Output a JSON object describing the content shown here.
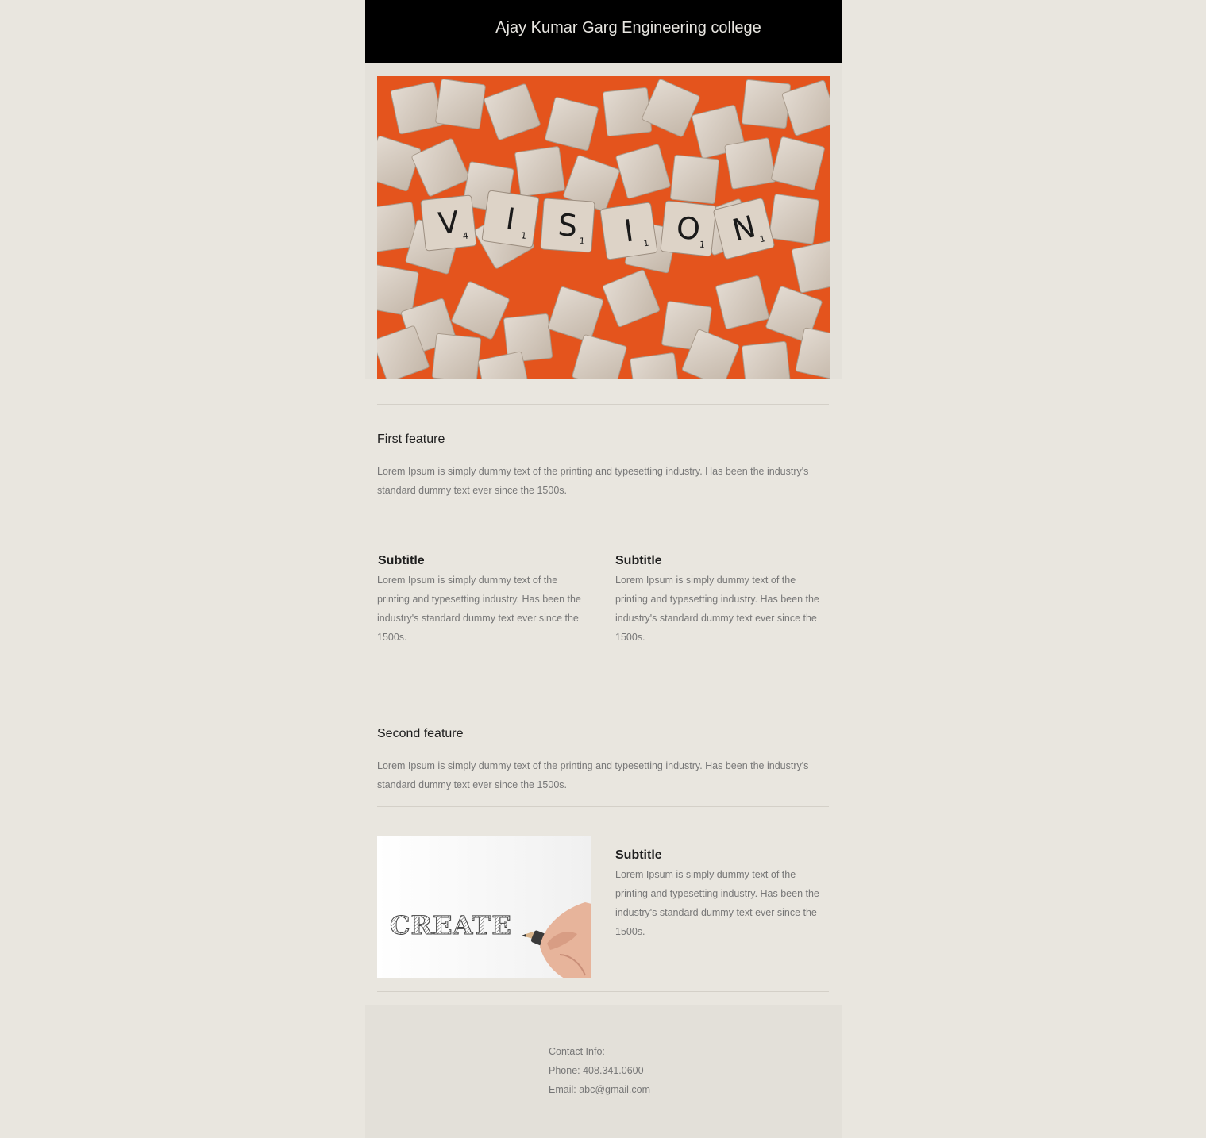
{
  "header": {
    "title": "Ajay Kumar Garg Engineering college"
  },
  "hero": {
    "tile_letters": [
      "V",
      "I",
      "S",
      "I",
      "O",
      "N"
    ],
    "tile_points": [
      "4",
      "1",
      "1",
      "1",
      "1",
      "1"
    ]
  },
  "features": [
    {
      "title": "First feature",
      "text": "Lorem Ipsum is simply dummy text of the printing and typesetting industry. Has been the industry's standard dummy text ever since the 1500s."
    },
    {
      "title": "Second feature",
      "text": "Lorem Ipsum is simply dummy text of the printing and typesetting industry. Has been the industry's standard dummy text ever since the 1500s."
    }
  ],
  "columns": [
    {
      "subtitle": "Subtitle",
      "text": "Lorem Ipsum is simply dummy text of the printing and typesetting industry. Has been the industry's standard dummy text ever since the 1500s."
    },
    {
      "subtitle": "Subtitle",
      "text": "Lorem Ipsum is simply dummy text of the printing and typesetting industry. Has been the industry's standard dummy text ever since the 1500s."
    }
  ],
  "create_section": {
    "image_word": "CREATE",
    "subtitle": "Subtitle",
    "text": "Lorem Ipsum is simply dummy text of the printing and typesetting industry. Has been the industry's standard dummy text ever since the 1500s."
  },
  "footer": {
    "heading": "Contact Info:",
    "phone": "Phone: 408.341.0600",
    "email": "Email: abc@gmail.com"
  },
  "colors": {
    "page_background": "#e9e6df",
    "header_background": "#000000",
    "hero_background": "#e4541d",
    "text_muted": "#777777",
    "text_dark": "#1e1e1e"
  }
}
